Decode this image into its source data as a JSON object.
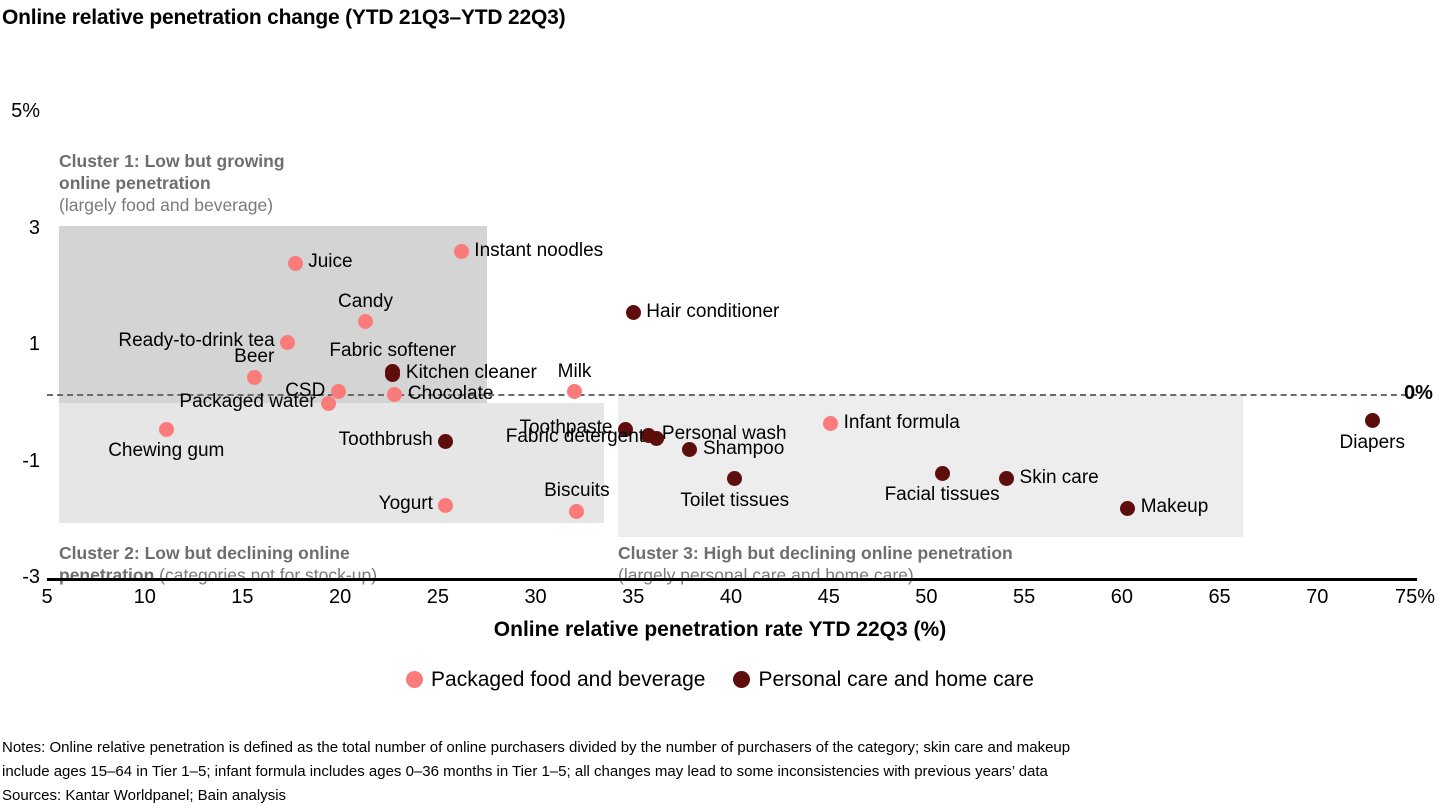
{
  "chart_data": {
    "type": "scatter",
    "title": "Online relative penetration change (YTD 21Q3–YTD 22Q3)",
    "xlabel": "Online relative penetration rate YTD 22Q3 (%)",
    "ylabel": "",
    "xlim": [
      5,
      75
    ],
    "ylim": [
      -3,
      5
    ],
    "xticks": [
      "5",
      "10",
      "15",
      "20",
      "25",
      "30",
      "35",
      "40",
      "45",
      "50",
      "55",
      "60",
      "65",
      "70",
      "75%"
    ],
    "xtick_values": [
      5,
      10,
      15,
      20,
      25,
      30,
      35,
      40,
      45,
      50,
      55,
      60,
      65,
      70,
      75
    ],
    "yticks": [
      "5%",
      "3",
      "1",
      "-1",
      "-3"
    ],
    "ytick_values": [
      5,
      3,
      1,
      -1,
      -3
    ],
    "grid": false,
    "zero_reference_line": {
      "value": 0,
      "label": "0%",
      "style": "dashed"
    },
    "legend_position": "bottom",
    "series": [
      {
        "name": "Packaged food and beverage",
        "color": "#fb7b7b",
        "points": [
          {
            "label": "Juice",
            "x": 17.7,
            "y": 2.4,
            "label_side": "right"
          },
          {
            "label": "Instant noodles",
            "x": 26.2,
            "y": 2.6,
            "label_side": "right"
          },
          {
            "label": "Candy",
            "x": 21.3,
            "y": 1.4,
            "label_side": "above"
          },
          {
            "label": "Ready-to-drink tea",
            "x": 17.3,
            "y": 1.05,
            "label_side": "left"
          },
          {
            "label": "Beer",
            "x": 15.6,
            "y": 0.45,
            "label_side": "above"
          },
          {
            "label": "CSD",
            "x": 19.9,
            "y": 0.2,
            "label_side": "left"
          },
          {
            "label": "Packaged water",
            "x": 19.4,
            "y": 0.0,
            "label_side": "left"
          },
          {
            "label": "Chocolate",
            "x": 22.8,
            "y": 0.15,
            "label_side": "right"
          },
          {
            "label": "Milk",
            "x": 32.0,
            "y": 0.2,
            "label_side": "above"
          },
          {
            "label": "Chewing gum",
            "x": 11.1,
            "y": -0.45,
            "label_side": "below"
          },
          {
            "label": "Yogurt",
            "x": 25.4,
            "y": -1.75,
            "label_side": "left"
          },
          {
            "label": "Biscuits",
            "x": 32.1,
            "y": -1.85,
            "label_side": "above"
          },
          {
            "label": "Infant formula",
            "x": 45.1,
            "y": -0.35,
            "label_side": "right"
          }
        ]
      },
      {
        "name": "Personal care and home care",
        "color": "#5e0d0d",
        "points": [
          {
            "label": "Fabric softener",
            "x": 22.7,
            "y": 0.55,
            "label_side": "above"
          },
          {
            "label": "Kitchen cleaner",
            "x": 22.7,
            "y": 0.5,
            "label_side": "right"
          },
          {
            "label": "Hair conditioner",
            "x": 35.0,
            "y": 1.55,
            "label_side": "right"
          },
          {
            "label": "Toothbrush",
            "x": 25.4,
            "y": -0.65,
            "label_side": "left"
          },
          {
            "label": "Toothpaste",
            "x": 34.6,
            "y": -0.45,
            "label_side": "left"
          },
          {
            "label": "Personal wash",
            "x": 35.8,
            "y": -0.55,
            "label_side": "right"
          },
          {
            "label": "Fabric detergent",
            "x": 36.2,
            "y": -0.6,
            "label_side": "left"
          },
          {
            "label": "Shampoo",
            "x": 37.9,
            "y": -0.8,
            "label_side": "right"
          },
          {
            "label": "Toilet tissues",
            "x": 40.2,
            "y": -1.3,
            "label_side": "below"
          },
          {
            "label": "Facial tissues",
            "x": 50.8,
            "y": -1.2,
            "label_side": "below"
          },
          {
            "label": "Skin care",
            "x": 54.1,
            "y": -1.3,
            "label_side": "right"
          },
          {
            "label": "Makeup",
            "x": 60.3,
            "y": -1.8,
            "label_side": "right"
          },
          {
            "label": "Diapers",
            "x": 72.8,
            "y": -0.3,
            "label_side": "below"
          }
        ]
      }
    ],
    "clusters": [
      {
        "id": "cluster-1",
        "heading": "Cluster 1: Low but growing online penetration",
        "subtext": "(largely food and beverage)",
        "x_range": [
          5.6,
          27.5
        ],
        "y_range": [
          0,
          3.05
        ],
        "fill": "#d4d4d4"
      },
      {
        "id": "cluster-2",
        "heading": "Cluster 2: Low but declining online penetration",
        "subtext": "(categories not for stock-up)",
        "x_range": [
          5.6,
          33.5
        ],
        "y_range": [
          -2.05,
          0
        ],
        "fill": "#e6e6e6"
      },
      {
        "id": "cluster-3",
        "heading": "Cluster 3: High but declining online penetration",
        "subtext": "(largely personal care and home care)",
        "x_range": [
          34.2,
          66.2
        ],
        "y_range": [
          -2.3,
          0.15
        ],
        "fill": "#ededed"
      }
    ],
    "annotations": [
      "Cluster 1: Low but growing online penetration (largely food and beverage)",
      "Cluster 2: Low but declining online penetration (categories not for stock-up)",
      "Cluster 3: High but declining online penetration (largely personal care and home care)"
    ]
  },
  "footnotes": {
    "notes_line1": "Notes: Online relative penetration is defined as the total number of online purchasers divided by the number of purchasers of the category; skin care and makeup",
    "notes_line2": "include ages 15–64 in Tier 1–5; infant formula includes ages 0–36 months in Tier 1–5; all changes may lead to some inconsistencies with previous years’ data",
    "sources": "Sources: Kantar Worldpanel; Bain analysis"
  },
  "cluster_text": {
    "c1_bold": "Cluster 1: Low but growing\nonline penetration",
    "c1_plain": "(largely food and beverage)",
    "c2_bold": "Cluster 2: Low but declining online\npenetration ",
    "c2_plain": "(categories not for stock-up)",
    "c3_bold": "Cluster 3: High but declining online penetration",
    "c3_plain": "(largely personal care and home care)"
  }
}
